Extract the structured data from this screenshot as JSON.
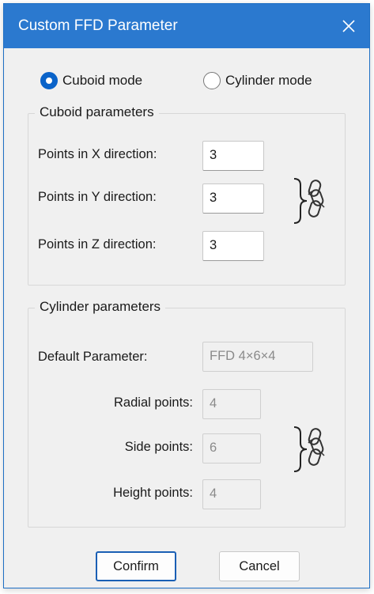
{
  "dialog": {
    "title": "Custom FFD Parameter",
    "close_icon": "close-icon"
  },
  "mode": {
    "cuboid_label": "Cuboid mode",
    "cylinder_label": "Cylinder mode",
    "selected": "cuboid"
  },
  "cuboid": {
    "group_title": "Cuboid parameters",
    "x_label": "Points in X direction:",
    "x_value": "3",
    "y_label": "Points in Y direction:",
    "y_value": "3",
    "z_label": "Points in Z direction:",
    "z_value": "3",
    "link_icon": "chain-link-icon"
  },
  "cylinder": {
    "group_title": "Cylinder parameters",
    "default_label": "Default Parameter:",
    "default_value": "FFD 4×6×4",
    "radial_label": "Radial points:",
    "radial_value": "4",
    "side_label": "Side points:",
    "side_value": "6",
    "height_label": "Height points:",
    "height_value": "4",
    "link_icon": "chain-link-icon"
  },
  "buttons": {
    "confirm": "Confirm",
    "cancel": "Cancel"
  },
  "colors": {
    "titlebar": "#2b79cf",
    "accent": "#0a63c9",
    "background": "#f0f0f0"
  }
}
